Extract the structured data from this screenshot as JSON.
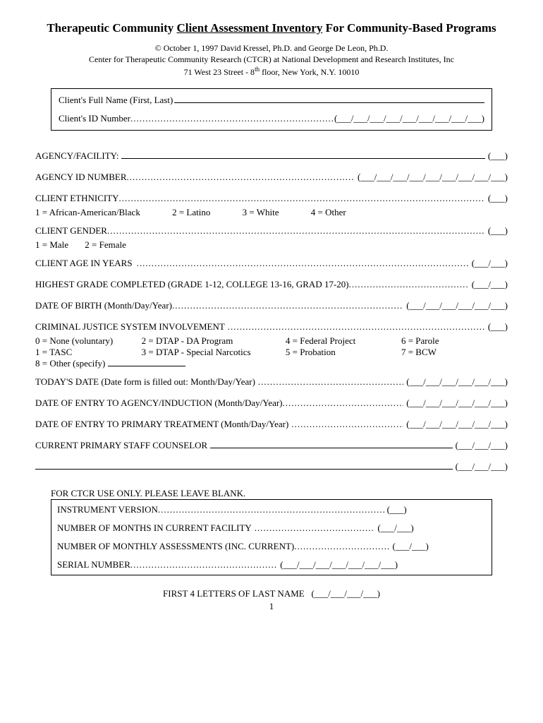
{
  "title_pre": "Therapeutic Community ",
  "title_underlined": "Client Assessment Inventory",
  "title_post": " For Community-Based Programs",
  "copyright": "© October 1, 1997 David Kressel, Ph.D. and George De Leon, Ph.D.",
  "center": "Center for Therapeutic Community Research (CTCR) at National Development and Research Institutes, Inc",
  "address_pre": "71 West 23 Street - 8",
  "address_sup": "th",
  "address_post": " floor, New York, N.Y. 10010",
  "box": {
    "name_label": "Client's Full Name (First, Last)",
    "id_label": "Client's ID Number",
    "id_paren": "(___/___/___/___/___/___/___/___/___)"
  },
  "fields": {
    "agency": {
      "label": "AGENCY/FACILITY:",
      "paren": "(___)"
    },
    "agency_id": {
      "label": "AGENCY ID NUMBER",
      "paren": "(___/___/___/___/___/___/___/___/___)"
    },
    "ethnicity": {
      "label": "CLIENT ETHNICITY",
      "paren": "(___)"
    },
    "ethnicity_opts": {
      "o1": "1 = African-American/Black",
      "o2": "2 = Latino",
      "o3": "3 = White",
      "o4": "4 = Other"
    },
    "gender": {
      "label": "CLIENT GENDER",
      "paren": "(___)"
    },
    "gender_opts": {
      "o1": "1 = Male",
      "o2": "2 = Female"
    },
    "age": {
      "label": "CLIENT AGE IN YEARS",
      "paren": "(___/___)"
    },
    "grade": {
      "label": "HIGHEST GRADE COMPLETED (GRADE 1-12, COLLEGE 13-16, GRAD 17-20)",
      "paren": "(___/___)"
    },
    "dob": {
      "label": "DATE OF BIRTH (Month/Day/Year)",
      "paren": "(___/___/___/___/___/___)"
    },
    "cjs": {
      "label": "CRIMINAL JUSTICE SYSTEM INVOLVEMENT",
      "paren": "(___)"
    },
    "cjs_opts": {
      "c0": "0 = None (voluntary)",
      "c1": "1 = TASC",
      "c2": "2 = DTAP - DA Program",
      "c3": "3 = DTAP -  Special Narcotics",
      "c4": "4 = Federal Project",
      "c5": "5 = Probation",
      "c6": "6 = Parole",
      "c7": "7 = BCW",
      "c8": "8 = Other (specify)"
    },
    "today": {
      "label": "TODAY'S DATE (Date form is filled out: Month/Day/Year)",
      "paren": "(___/___/___/___/___/___)"
    },
    "entry_agency": {
      "label": "DATE OF ENTRY TO AGENCY/INDUCTION (Month/Day/Year)",
      "paren": "(___/___/___/___/___/___)"
    },
    "entry_treatment": {
      "label": "DATE OF ENTRY TO PRIMARY TREATMENT (Month/Day/Year)",
      "paren": "(___/___/___/___/___/___)"
    },
    "counselor": {
      "label": "CURRENT PRIMARY STAFF COUNSELOR",
      "paren": "(___/___/___)"
    },
    "counselor2": {
      "paren": "(___/___/___)"
    }
  },
  "ctcr": {
    "heading": "FOR CTCR USE ONLY.  PLEASE LEAVE BLANK.",
    "version": {
      "label": "INSTRUMENT VERSION",
      "paren": "(___)"
    },
    "months": {
      "label": "NUMBER OF MONTHS IN CURRENT FACILITY",
      "paren": "(___/___)"
    },
    "assessments": {
      "label": "NUMBER OF MONTHLY ASSESSMENTS (INC. CURRENT)",
      "paren": "(___/___)"
    },
    "serial": {
      "label": "SERIAL NUMBER",
      "paren": "(___/___/___/___/___/___/___)"
    }
  },
  "footer": {
    "label": "FIRST 4 LETTERS OF LAST NAME",
    "paren": "(___/___/___/___)"
  },
  "page": "1"
}
